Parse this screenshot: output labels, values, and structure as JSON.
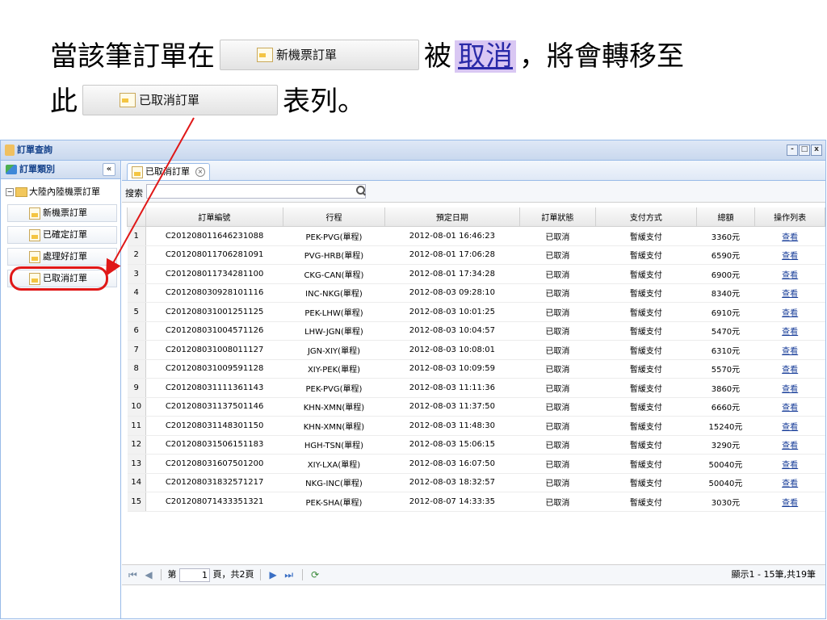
{
  "instruction": {
    "p1": "當該筆訂單在",
    "new_button": "新機票訂單",
    "p2": "被",
    "cancel_word": "取消",
    "p3": "，將會轉移至",
    "p4": "此",
    "cancelled_button": "已取消訂單",
    "p5": "表列。"
  },
  "window": {
    "title": "訂單查詢",
    "tools": [
      "-",
      "□",
      "x"
    ]
  },
  "sidebar": {
    "header": "訂單類別",
    "collapse": "«",
    "root": "大陸內陸機票訂單",
    "items": [
      {
        "label": "新機票訂單"
      },
      {
        "label": "已確定訂單"
      },
      {
        "label": "處理好訂單"
      },
      {
        "label": "已取消訂單"
      }
    ]
  },
  "tab": {
    "label": "已取消訂單",
    "close": "×"
  },
  "search": {
    "label": "搜索"
  },
  "table": {
    "columns": [
      "訂單編號",
      "行程",
      "預定日期",
      "訂單狀態",
      "支付方式",
      "總額",
      "操作列表"
    ],
    "rows": [
      {
        "n": "1",
        "id": "C201208011646231088",
        "route": "PEK-PVG(單程)",
        "date": "2012-08-01 16:46:23",
        "status": "已取消",
        "pay": "暫緩支付",
        "total": "3360元",
        "op": "查看"
      },
      {
        "n": "2",
        "id": "C201208011706281091",
        "route": "PVG-HRB(單程)",
        "date": "2012-08-01 17:06:28",
        "status": "已取消",
        "pay": "暫緩支付",
        "total": "6590元",
        "op": "查看"
      },
      {
        "n": "3",
        "id": "C201208011734281100",
        "route": "CKG-CAN(單程)",
        "date": "2012-08-01 17:34:28",
        "status": "已取消",
        "pay": "暫緩支付",
        "total": "6900元",
        "op": "查看"
      },
      {
        "n": "4",
        "id": "C201208030928101116",
        "route": "INC-NKG(單程)",
        "date": "2012-08-03 09:28:10",
        "status": "已取消",
        "pay": "暫緩支付",
        "total": "8340元",
        "op": "查看"
      },
      {
        "n": "5",
        "id": "C201208031001251125",
        "route": "PEK-LHW(單程)",
        "date": "2012-08-03 10:01:25",
        "status": "已取消",
        "pay": "暫緩支付",
        "total": "6910元",
        "op": "查看"
      },
      {
        "n": "6",
        "id": "C201208031004571126",
        "route": "LHW-JGN(單程)",
        "date": "2012-08-03 10:04:57",
        "status": "已取消",
        "pay": "暫緩支付",
        "total": "5470元",
        "op": "查看"
      },
      {
        "n": "7",
        "id": "C201208031008011127",
        "route": "JGN-XIY(單程)",
        "date": "2012-08-03 10:08:01",
        "status": "已取消",
        "pay": "暫緩支付",
        "total": "6310元",
        "op": "查看"
      },
      {
        "n": "8",
        "id": "C201208031009591128",
        "route": "XIY-PEK(單程)",
        "date": "2012-08-03 10:09:59",
        "status": "已取消",
        "pay": "暫緩支付",
        "total": "5570元",
        "op": "查看"
      },
      {
        "n": "9",
        "id": "C201208031111361143",
        "route": "PEK-PVG(單程)",
        "date": "2012-08-03 11:11:36",
        "status": "已取消",
        "pay": "暫緩支付",
        "total": "3860元",
        "op": "查看"
      },
      {
        "n": "10",
        "id": "C201208031137501146",
        "route": "KHN-XMN(單程)",
        "date": "2012-08-03 11:37:50",
        "status": "已取消",
        "pay": "暫緩支付",
        "total": "6660元",
        "op": "查看"
      },
      {
        "n": "11",
        "id": "C201208031148301150",
        "route": "KHN-XMN(單程)",
        "date": "2012-08-03 11:48:30",
        "status": "已取消",
        "pay": "暫緩支付",
        "total": "15240元",
        "op": "查看"
      },
      {
        "n": "12",
        "id": "C201208031506151183",
        "route": "HGH-TSN(單程)",
        "date": "2012-08-03 15:06:15",
        "status": "已取消",
        "pay": "暫緩支付",
        "total": "3290元",
        "op": "查看"
      },
      {
        "n": "13",
        "id": "C201208031607501200",
        "route": "XIY-LXA(單程)",
        "date": "2012-08-03 16:07:50",
        "status": "已取消",
        "pay": "暫緩支付",
        "total": "50040元",
        "op": "查看"
      },
      {
        "n": "14",
        "id": "C201208031832571217",
        "route": "NKG-INC(單程)",
        "date": "2012-08-03 18:32:57",
        "status": "已取消",
        "pay": "暫緩支付",
        "total": "50040元",
        "op": "查看"
      },
      {
        "n": "15",
        "id": "C201208071433351321",
        "route": "PEK-SHA(單程)",
        "date": "2012-08-07 14:33:35",
        "status": "已取消",
        "pay": "暫緩支付",
        "total": "3030元",
        "op": "查看"
      }
    ]
  },
  "pager": {
    "page_prefix": "第",
    "page_value": "1",
    "page_suffix": "頁，共2頁",
    "info": "顯示1 - 15筆,共19筆"
  },
  "colors": {
    "accent_border": "#99bbe8",
    "highlight_red": "#e01818",
    "link": "#1a3f9a"
  }
}
